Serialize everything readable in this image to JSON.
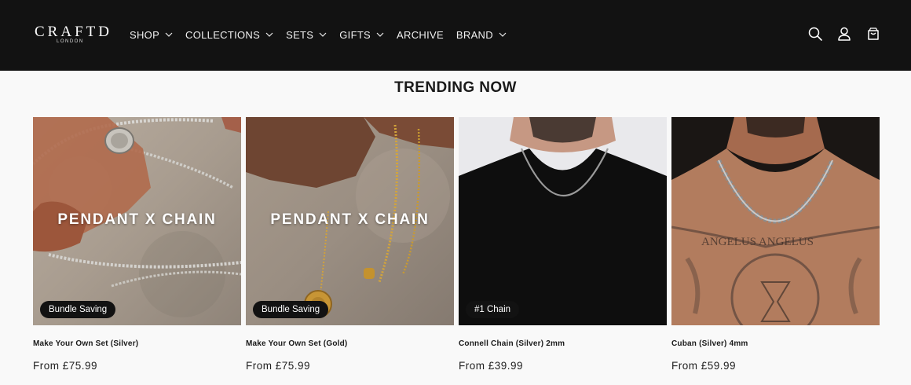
{
  "brand": {
    "logo_main": "CRAFTD",
    "logo_sub": "LONDON"
  },
  "nav": [
    {
      "label": "SHOP"
    },
    {
      "label": "COLLECTIONS"
    },
    {
      "label": "SETS"
    },
    {
      "label": "GIFTS"
    },
    {
      "label": "ARCHIVE"
    },
    {
      "label": "BRAND"
    }
  ],
  "header_icons": [
    "search-icon",
    "account-icon",
    "cart-icon"
  ],
  "section": {
    "title": "TRENDING NOW"
  },
  "products": [
    {
      "title": "Make Your Own Set (Silver)",
      "price": "From £75.99",
      "badge": "Bundle Saving",
      "overlay": "PENDANT  X  CHAIN"
    },
    {
      "title": "Make Your Own Set (Gold)",
      "price": "From £75.99",
      "badge": "Bundle Saving",
      "overlay": "PENDANT  X  CHAIN"
    },
    {
      "title": "Connell Chain (Silver) 2mm",
      "price": "From £39.99",
      "badge": "#1 Chain",
      "overlay": ""
    },
    {
      "title": "Cuban (Silver) 4mm",
      "price": "From £59.99",
      "badge": "",
      "overlay": ""
    }
  ],
  "colors": {
    "header_bg": "#121212",
    "page_bg": "#f9f9f9",
    "badge_bg": "#121212"
  }
}
